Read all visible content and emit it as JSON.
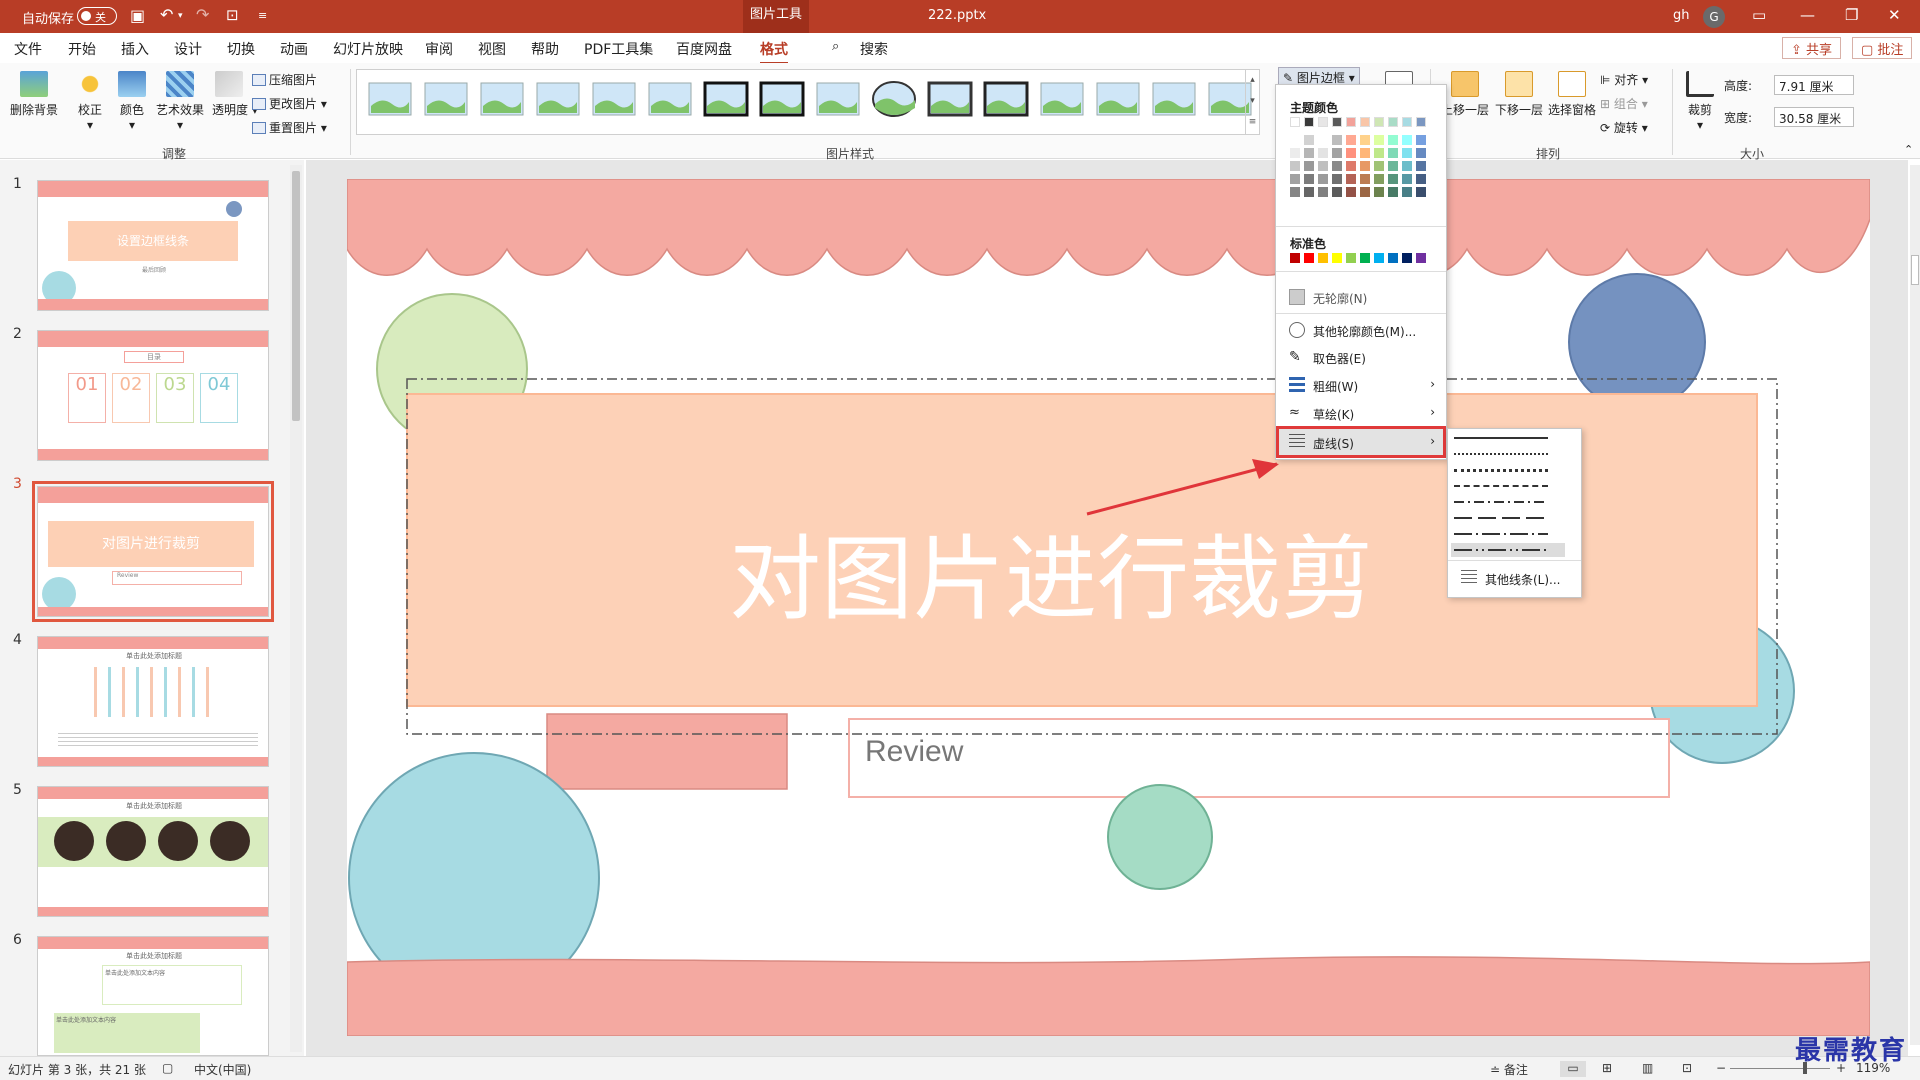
{
  "titlebar": {
    "autosave": "自动保存",
    "toggle_state": "关",
    "context_tab": "图片工具",
    "filename": "222.pptx",
    "user": "gh",
    "avatar_letter": "G"
  },
  "menu": {
    "tabs": [
      "文件",
      "开始",
      "插入",
      "设计",
      "切换",
      "动画",
      "幻灯片放映",
      "审阅",
      "视图",
      "帮助",
      "PDF工具集",
      "百度网盘",
      "格式"
    ],
    "active_tab": "格式",
    "search": "搜索",
    "share": "共享",
    "comment": "批注"
  },
  "ribbon": {
    "remove_bg": "删除背景",
    "correct": "校正",
    "color": "颜色",
    "art_effects": "艺术效果",
    "transparency": "透明度",
    "compress": "压缩图片",
    "change_pic": "更改图片",
    "reset_pic": "重置图片",
    "group_adjust": "调整",
    "group_styles": "图片样式",
    "picture_border": "图片边框",
    "bring_forward": "上移一层",
    "send_backward": "下移一层",
    "selection_pane": "选择窗格",
    "align": "对齐",
    "group": "组合",
    "rotate": "旋转",
    "group_arrange": "排列",
    "crop": "裁剪",
    "height_label": "高度:",
    "height_value": "7.91 厘米",
    "width_label": "宽度:",
    "width_value": "30.58 厘米",
    "group_size": "大小"
  },
  "dropdown": {
    "theme_colors": "主题颜色",
    "standard_colors": "标准色",
    "no_outline": "无轮廓(N)",
    "more_colors": "其他轮廓颜色(M)...",
    "eyedropper": "取色器(E)",
    "weight": "粗细(W)",
    "sketch": "草绘(K)",
    "dashes": "虚线(S)",
    "standard_palette": [
      "#c00000",
      "#ff0000",
      "#ffc000",
      "#ffff00",
      "#92d050",
      "#00b050",
      "#00b0f0",
      "#0070c0",
      "#002060",
      "#7030a0"
    ]
  },
  "submenu": {
    "more_lines": "其他线条(L)..."
  },
  "slides": {
    "numbers": [
      "1",
      "2",
      "3",
      "4",
      "5",
      "6"
    ],
    "s1_title": "设置边框线条",
    "s1_sub": "最后回顾",
    "s2_title": "目录",
    "s2_items": [
      "01",
      "02",
      "03",
      "04"
    ],
    "s3_title": "对图片进行裁剪",
    "s3_sub": "Review",
    "s4_title": "单击此处添加标题",
    "s5_title": "单击此处添加标题",
    "s6_title": "单击此处添加标题",
    "s6_text1": "单击此处添加文本内容",
    "s6_text2": "单击此处添加文本内容"
  },
  "main_slide": {
    "title": "对图片进行裁剪",
    "subtitle": "Review"
  },
  "status": {
    "slide_info": "幻灯片 第 3 张，共 21 张",
    "language": "中文(中国)",
    "notes": "备注",
    "zoom": "119%"
  },
  "watermark": "最需教育"
}
